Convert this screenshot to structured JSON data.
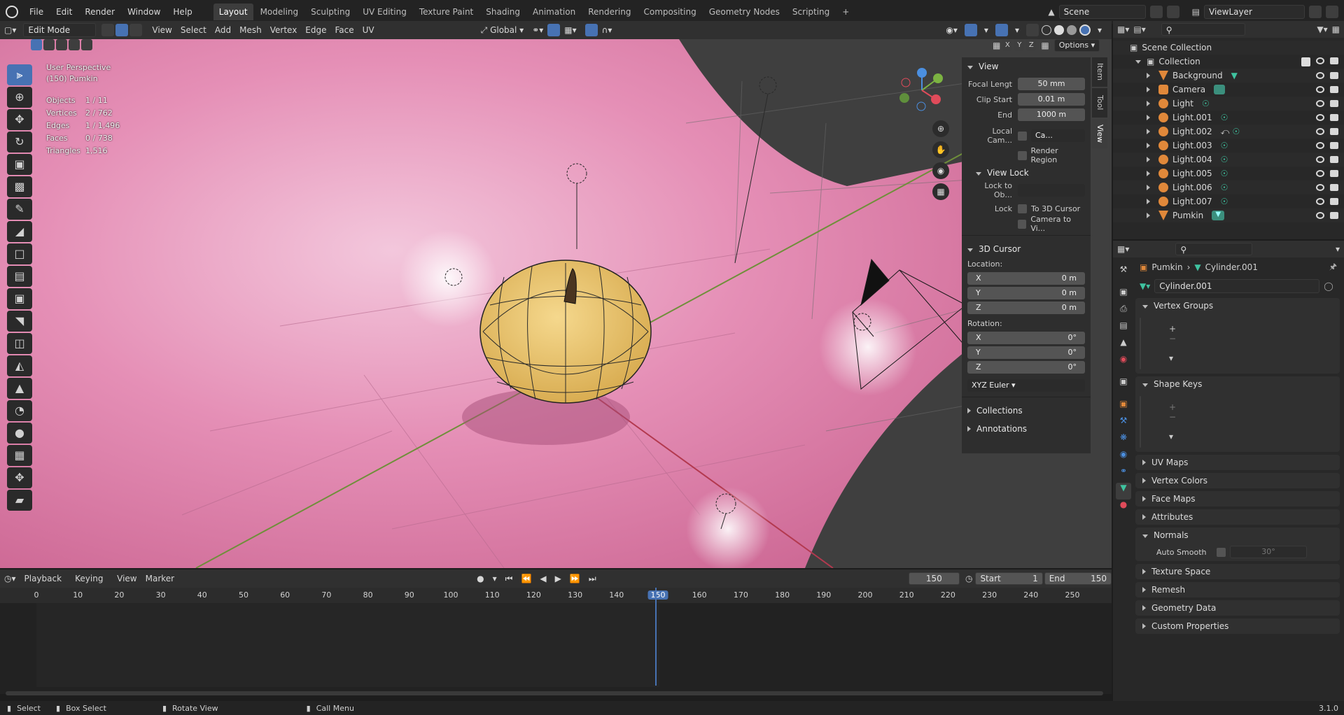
{
  "topbar": {
    "menus": [
      "File",
      "Edit",
      "Render",
      "Window",
      "Help"
    ],
    "workspaces": [
      "Layout",
      "Modeling",
      "Sculpting",
      "UV Editing",
      "Texture Paint",
      "Shading",
      "Animation",
      "Rendering",
      "Compositing",
      "Geometry Nodes",
      "Scripting"
    ],
    "active_workspace": "Layout",
    "scene": "Scene",
    "view_layer": "ViewLayer"
  },
  "viewport_header": {
    "mode": "Edit Mode",
    "menus": [
      "View",
      "Select",
      "Add",
      "Mesh",
      "Vertex",
      "Edge",
      "Face",
      "UV"
    ],
    "orientation": "Global",
    "axes": [
      "X",
      "Y",
      "Z"
    ],
    "options": "Options"
  },
  "overlay": {
    "perspective": "User Perspective",
    "object": "(150) Pumkin",
    "stats": [
      {
        "label": "Objects",
        "value": "1 / 11"
      },
      {
        "label": "Vertices",
        "value": "2 / 762"
      },
      {
        "label": "Edges",
        "value": "1 / 1,496"
      },
      {
        "label": "Faces",
        "value": "0 / 738"
      },
      {
        "label": "Triangles",
        "value": "1,516"
      }
    ]
  },
  "npanel": {
    "tabs": [
      "Item",
      "Tool",
      "View"
    ],
    "view": {
      "title": "View",
      "focal_label": "Focal Lengt",
      "focal_value": "50 mm",
      "clip_start_label": "Clip Start",
      "clip_start_value": "0.01 m",
      "end_label": "End",
      "end_value": "1000 m",
      "local_cam_label": "Local Cam...",
      "local_cam_value": "Ca...",
      "render_region": "Render Region"
    },
    "view_lock": {
      "title": "View Lock",
      "lock_to_ob_label": "Lock to Ob...",
      "lock_label": "Lock",
      "to_3d_cursor": "To 3D Cursor",
      "camera_to_view": "Camera to Vi..."
    },
    "cursor": {
      "title": "3D Cursor",
      "location_label": "Location:",
      "loc": [
        {
          "axis": "X",
          "value": "0 m"
        },
        {
          "axis": "Y",
          "value": "0 m"
        },
        {
          "axis": "Z",
          "value": "0 m"
        }
      ],
      "rotation_label": "Rotation:",
      "rot": [
        {
          "axis": "X",
          "value": "0°"
        },
        {
          "axis": "Y",
          "value": "0°"
        },
        {
          "axis": "Z",
          "value": "0°"
        }
      ],
      "rotation_mode": "XYZ Euler"
    },
    "collections": "Collections",
    "annotations": "Annotations"
  },
  "outliner": {
    "root": "Scene Collection",
    "collection": "Collection",
    "items": [
      "Background",
      "Camera",
      "Light",
      "Light.001",
      "Light.002",
      "Light.003",
      "Light.004",
      "Light.005",
      "Light.006",
      "Light.007",
      "Pumkin"
    ]
  },
  "properties": {
    "object": "Pumkin",
    "mesh": "Cylinder.001",
    "mesh_field": "Cylinder.001",
    "panels": {
      "vertex_groups": "Vertex Groups",
      "shape_keys": "Shape Keys",
      "uv_maps": "UV Maps",
      "vertex_colors": "Vertex Colors",
      "face_maps": "Face Maps",
      "attributes": "Attributes",
      "normals": "Normals",
      "auto_smooth": "Auto Smooth",
      "auto_smooth_angle": "30°",
      "texture_space": "Texture Space",
      "remesh": "Remesh",
      "geometry_data": "Geometry Data",
      "custom_properties": "Custom Properties"
    }
  },
  "timeline": {
    "menus": [
      "Playback",
      "Keying",
      "View",
      "Marker"
    ],
    "current_frame": "150",
    "start_label": "Start",
    "start": "1",
    "end_label": "End",
    "end": "150",
    "ticks": [
      "0",
      "10",
      "20",
      "30",
      "40",
      "50",
      "60",
      "70",
      "80",
      "90",
      "100",
      "110",
      "120",
      "130",
      "140",
      "150",
      "160",
      "170",
      "180",
      "190",
      "200",
      "210",
      "220",
      "230",
      "240",
      "250"
    ]
  },
  "statusbar": {
    "select": "Select",
    "box_select": "Box Select",
    "rotate_view": "Rotate View",
    "call_menu": "Call Menu",
    "version": "3.1.0"
  }
}
